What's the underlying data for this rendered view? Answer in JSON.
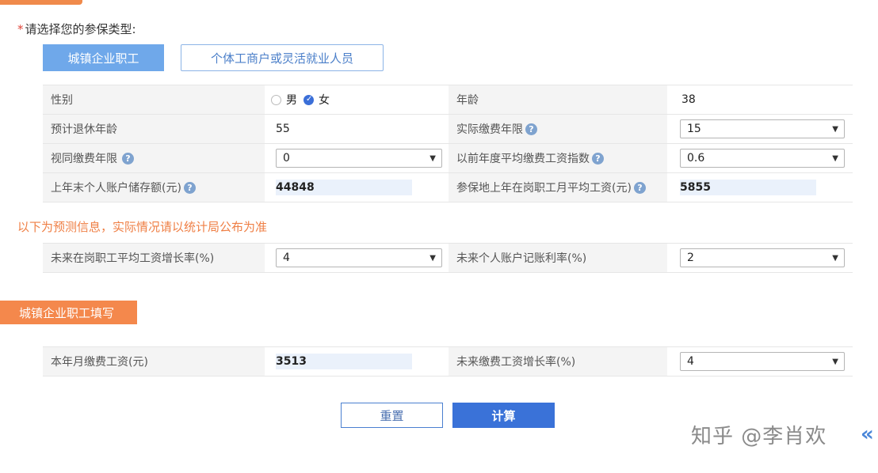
{
  "header": {
    "required_mark": "*",
    "question": "请选择您的参保类型:"
  },
  "insurance_types": [
    {
      "label": "城镇企业职工",
      "active": true
    },
    {
      "label": "个体工商户或灵活就业人员",
      "active": false
    }
  ],
  "basic_info": {
    "gender_label": "性别",
    "gender_options": [
      "男",
      "女"
    ],
    "gender_selected": "女",
    "age_label": "年龄",
    "age_value": "38",
    "retire_age_label": "预计退休年龄",
    "retire_age_value": "55",
    "actual_years_label": "实际缴费年限",
    "actual_years_value": "15",
    "deemed_years_label": "视同缴费年限",
    "deemed_years_value": "0",
    "avg_index_label": "以前年度平均缴费工资指数",
    "avg_index_value": "0.6",
    "account_balance_label": "上年末个人账户储存额(元)",
    "account_balance_value": "44848",
    "avg_wage_label": "参保地上年在岗职工月平均工资(元)",
    "avg_wage_value": "5855"
  },
  "forecast_notice": "以下为预测信息，实际情况请以统计局公布为准",
  "forecast": {
    "wage_growth_label": "未来在岗职工平均工资增长率(%)",
    "wage_growth_value": "4",
    "account_rate_label": "未来个人账户记账利率(%)",
    "account_rate_value": "2"
  },
  "section_title": "城镇企业职工填写",
  "employee": {
    "monthly_wage_label": "本年月缴费工资(元)",
    "monthly_wage_value": "3513",
    "future_growth_label": "未来缴费工资增长率(%)",
    "future_growth_value": "4"
  },
  "buttons": {
    "reset": "重置",
    "calculate": "计算"
  },
  "watermark": "知乎 @李肖欢",
  "icons": {
    "help": "?",
    "dropdown": "▼",
    "chevron": "«"
  },
  "colors": {
    "accent_orange": "#f4884c",
    "primary_blue": "#3a72d8",
    "tab_blue": "#6fa8ea"
  }
}
